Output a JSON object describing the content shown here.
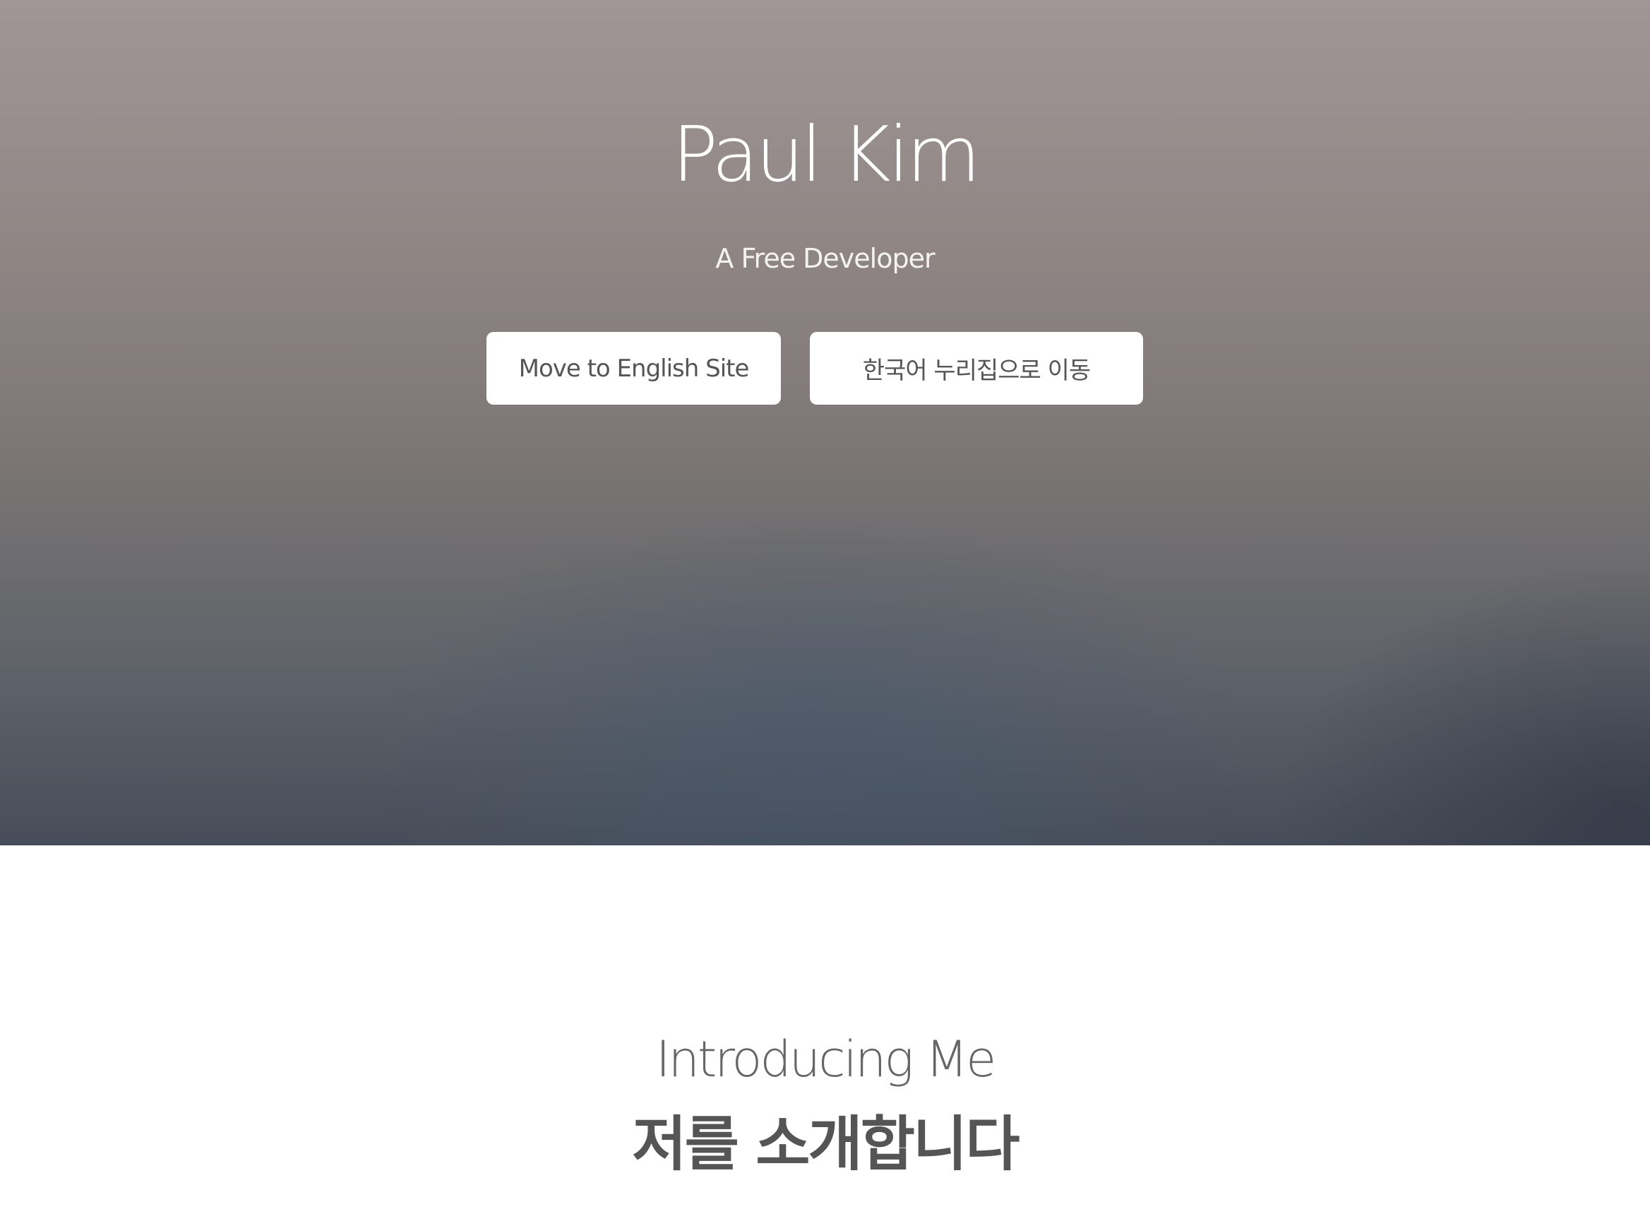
{
  "hero": {
    "title": "Paul Kim",
    "subtitle": "A Free Developer",
    "buttons": {
      "english": "Move to English Site",
      "korean": "한국어 누리집으로 이동"
    }
  },
  "intro": {
    "title": "Introducing Me",
    "subtitle": "저를 소개합니다"
  },
  "colors": {
    "button_bg": "#ffffff",
    "button_text": "#555555",
    "hero_text": "#ffffff",
    "page_bg": "#ffffff"
  }
}
